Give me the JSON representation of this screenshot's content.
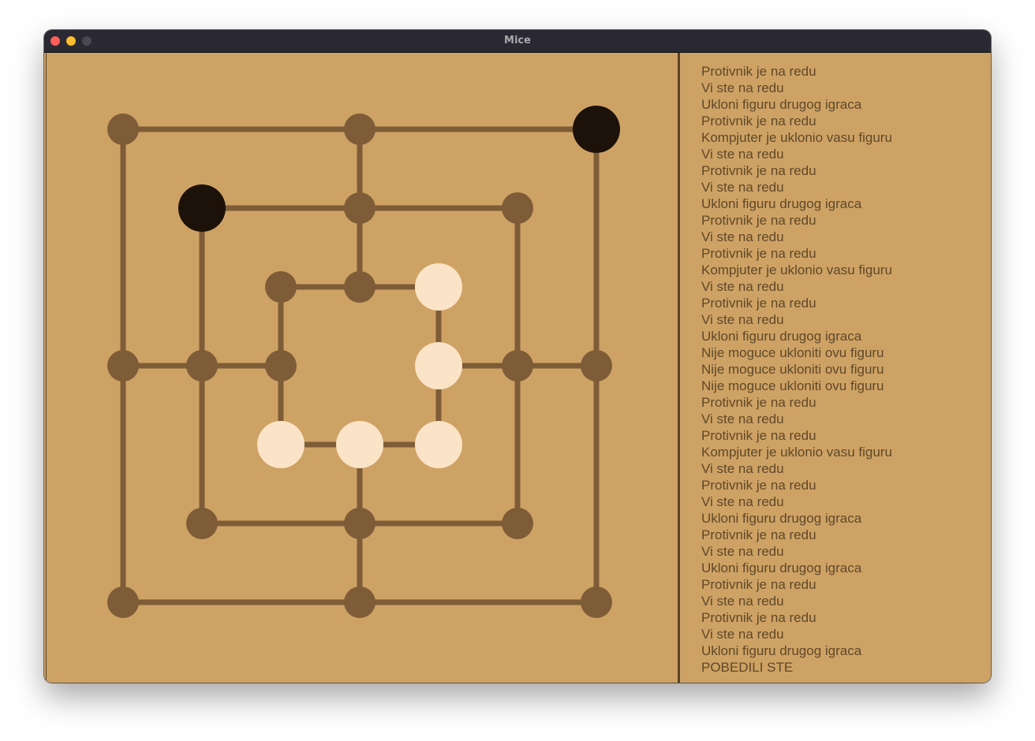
{
  "window": {
    "title": "Mice",
    "traffic_lights": [
      "close",
      "minimize",
      "zoom"
    ]
  },
  "colors": {
    "board_background": "#cea265",
    "line_and_empty_point": "#7e5c37",
    "black_piece": "#1c1209",
    "white_piece": "#fbe3c7",
    "log_text": "#5f4828"
  },
  "board": {
    "points": [
      {
        "id": "a1",
        "piece": "empty"
      },
      {
        "id": "a2",
        "piece": "empty"
      },
      {
        "id": "a3",
        "piece": "black"
      },
      {
        "id": "b1",
        "piece": "black"
      },
      {
        "id": "b2",
        "piece": "empty"
      },
      {
        "id": "b3",
        "piece": "empty"
      },
      {
        "id": "c1",
        "piece": "empty"
      },
      {
        "id": "c2",
        "piece": "empty"
      },
      {
        "id": "c3",
        "piece": "white"
      },
      {
        "id": "d1",
        "piece": "empty"
      },
      {
        "id": "d2",
        "piece": "empty"
      },
      {
        "id": "d3",
        "piece": "empty"
      },
      {
        "id": "d4",
        "piece": "white"
      },
      {
        "id": "d5",
        "piece": "empty"
      },
      {
        "id": "d6",
        "piece": "empty"
      },
      {
        "id": "e1",
        "piece": "white"
      },
      {
        "id": "e2",
        "piece": "white"
      },
      {
        "id": "e3",
        "piece": "white"
      },
      {
        "id": "f1",
        "piece": "empty"
      },
      {
        "id": "f2",
        "piece": "empty"
      },
      {
        "id": "f3",
        "piece": "empty"
      },
      {
        "id": "g1",
        "piece": "empty"
      },
      {
        "id": "g2",
        "piece": "empty"
      },
      {
        "id": "g3",
        "piece": "empty"
      }
    ]
  },
  "log": [
    "Protivnik je na redu",
    "Vi ste na redu",
    "Ukloni figuru drugog igraca",
    "Protivnik je na redu",
    "Kompjuter je uklonio vasu figuru",
    "Vi ste na redu",
    "Protivnik je na redu",
    "Vi ste na redu",
    "Ukloni figuru drugog igraca",
    "Protivnik je na redu",
    "Vi ste na redu",
    "Protivnik je na redu",
    "Kompjuter je uklonio vasu figuru",
    "Vi ste na redu",
    "Protivnik je na redu",
    "Vi ste na redu",
    "Ukloni figuru drugog igraca",
    "Nije moguce ukloniti ovu figuru",
    "Nije moguce ukloniti ovu figuru",
    "Nije moguce ukloniti ovu figuru",
    "Protivnik je na redu",
    "Vi ste na redu",
    "Protivnik je na redu",
    "Kompjuter je uklonio vasu figuru",
    "Vi ste na redu",
    "Protivnik je na redu",
    "Vi ste na redu",
    "Ukloni figuru drugog igraca",
    "Protivnik je na redu",
    "Vi ste na redu",
    "Ukloni figuru drugog igraca",
    "Protivnik je na redu",
    "Vi ste na redu",
    "Protivnik je na redu",
    "Vi ste na redu",
    "Ukloni figuru drugog igraca",
    "POBEDILI STE"
  ]
}
